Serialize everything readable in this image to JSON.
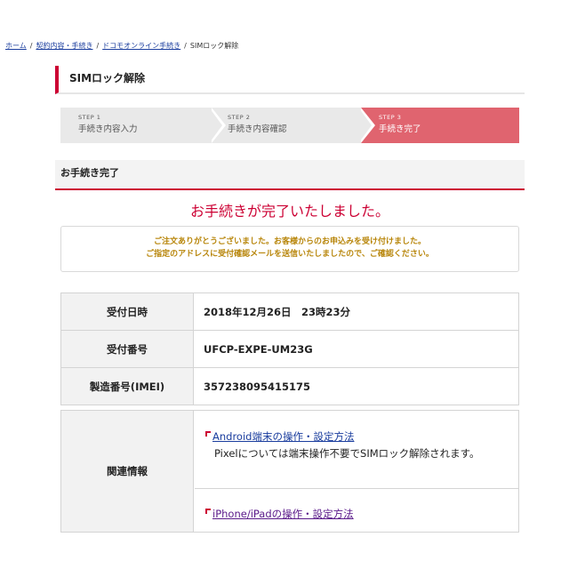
{
  "breadcrumb": {
    "items": [
      "ホーム",
      "契約内容・手続き",
      "ドコモオンライン手続き"
    ],
    "current": "SIMロック解除",
    "separator": "/"
  },
  "page_title": "SIMロック解除",
  "steps": [
    {
      "no": "STEP 1",
      "label": "手続き内容入力",
      "state": "done"
    },
    {
      "no": "STEP 2",
      "label": "手続き内容確認",
      "state": "done"
    },
    {
      "no": "STEP 3",
      "label": "手続き完了",
      "state": "active"
    }
  ],
  "section_title": "お手続き完了",
  "complete_message": "お手続きが完了いたしました。",
  "notice": {
    "line1": "ご注文ありがとうございました。お客様からのお申込みを受け付けました。",
    "line2": "ご指定のアドレスに受付確認メールを送信いたしましたので、ご確認ください。"
  },
  "info_rows": [
    {
      "label": "受付日時",
      "value": "2018年12月26日　23時23分"
    },
    {
      "label": "受付番号",
      "value": "UFCP-EXPE-UM23G"
    },
    {
      "label": "製造番号(IMEI)",
      "value": "357238095415175"
    }
  ],
  "related": {
    "label": "関連情報",
    "link1": "Android端末の操作・設定方法",
    "link1_note": "Pixelについては端末操作不要でSIMロック解除されます。",
    "link2": "iPhone/iPadの操作・設定方法"
  },
  "colors": {
    "accent": "#cc0033",
    "step_active": "#e0646f",
    "notice_text": "#b8860b",
    "link": "#1a3d9e"
  }
}
